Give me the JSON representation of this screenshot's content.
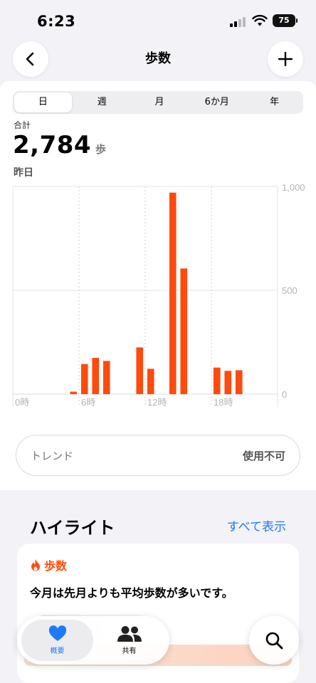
{
  "status_bar": {
    "time": "6:23",
    "battery": "75"
  },
  "nav": {
    "title": "歩数",
    "back_icon": "chevron-left-icon",
    "add_icon": "plus-icon"
  },
  "segments": [
    "日",
    "週",
    "月",
    "6か月",
    "年"
  ],
  "selected_segment": "日",
  "summary": {
    "label": "合計",
    "value": "2,784",
    "unit": "歩",
    "period": "昨日"
  },
  "chart_data": {
    "type": "bar",
    "x_tick_labels": [
      "0時",
      "6時",
      "12時",
      "18時"
    ],
    "y_tick_labels": [
      "1,000",
      "500",
      "0"
    ],
    "ylim": [
      0,
      1000
    ],
    "hours": [
      0,
      1,
      2,
      3,
      4,
      5,
      6,
      7,
      8,
      9,
      10,
      11,
      12,
      13,
      14,
      15,
      16,
      17,
      18,
      19,
      20,
      21,
      22,
      23
    ],
    "values": [
      0,
      0,
      0,
      0,
      0,
      12,
      145,
      175,
      160,
      0,
      0,
      225,
      122,
      0,
      970,
      605,
      0,
      0,
      128,
      112,
      115,
      0,
      0,
      0
    ],
    "bar_color": "#ff4a0d",
    "grid": true
  },
  "trend": {
    "label": "トレンド",
    "value": "使用不可"
  },
  "highlights": {
    "title": "ハイライト",
    "see_all": "すべて表示",
    "card_tag": "歩数",
    "card_text": "今月は先月よりも平均歩数が多いです。"
  },
  "tabbar": {
    "tabs": [
      {
        "label": "概要",
        "icon": "heart-icon"
      },
      {
        "label": "共有",
        "icon": "people-icon"
      }
    ],
    "search_icon": "search-icon"
  }
}
